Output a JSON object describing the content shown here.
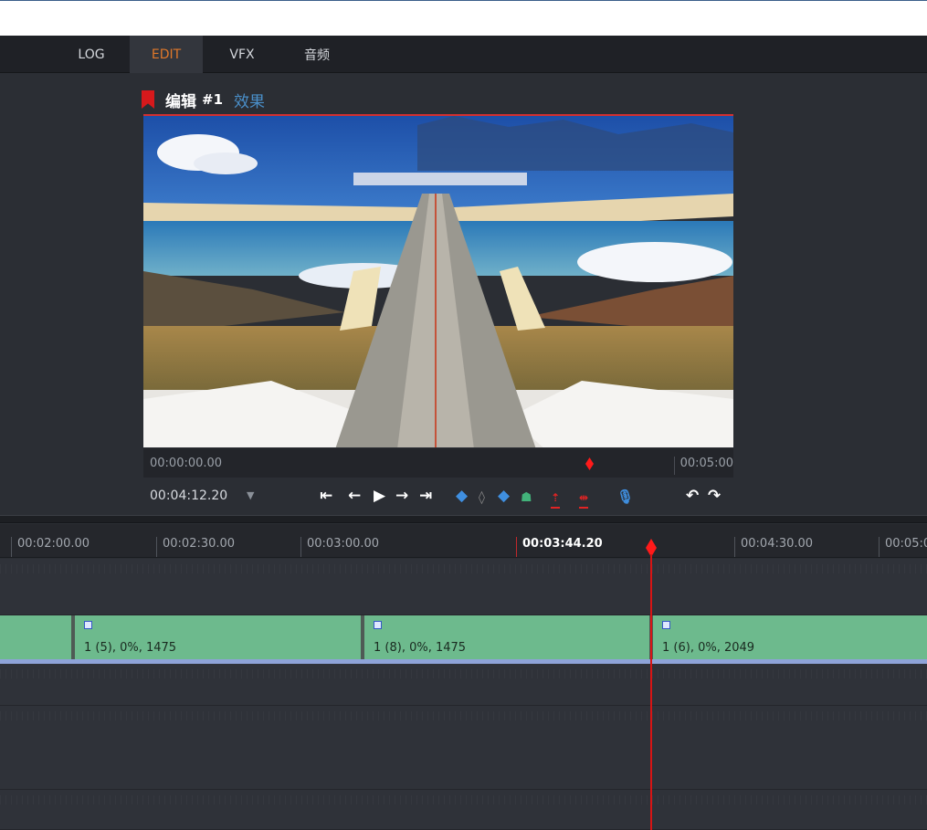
{
  "tabs": [
    {
      "label": "LOG",
      "active": false
    },
    {
      "label": "EDIT",
      "active": true
    },
    {
      "label": "VFX",
      "active": false
    },
    {
      "label": "音频",
      "active": false
    }
  ],
  "viewer": {
    "title": "编辑",
    "number": "#1",
    "effects_label": "效果",
    "scrub_start": "00:00:00.00",
    "scrub_end": "00:05:00",
    "timecode": "00:04:12.20",
    "timecode_dropdown": "▼"
  },
  "transport_icons": [
    {
      "name": "go-to-start-icon",
      "glyph": "⇤"
    },
    {
      "name": "step-back-icon",
      "glyph": "←"
    },
    {
      "name": "play-icon",
      "glyph": "▶"
    },
    {
      "name": "step-forward-icon",
      "glyph": "→"
    },
    {
      "name": "go-to-end-icon",
      "glyph": "⇥"
    },
    {
      "name": "mark-in-icon",
      "glyph": "◆"
    },
    {
      "name": "clear-mark-icon",
      "glyph": "◊"
    },
    {
      "name": "mark-out-icon",
      "glyph": "◆"
    },
    {
      "name": "add-marker-icon",
      "glyph": "☗"
    },
    {
      "name": "lift-icon",
      "glyph": "⇡"
    },
    {
      "name": "extract-icon",
      "glyph": "⇹"
    },
    {
      "name": "voiceover-mic-icon",
      "glyph": "🎙"
    },
    {
      "name": "undo-icon",
      "glyph": "↶"
    },
    {
      "name": "redo-icon",
      "glyph": "↷"
    }
  ],
  "timeline": {
    "ruler_labels": [
      "00:02:00.00",
      "00:02:30.00",
      "00:03:00.00",
      "00:03:44.20",
      "00:04:30.00",
      "00:05:0"
    ],
    "current_time": "00:03:44.20",
    "clips": [
      {
        "label": ""
      },
      {
        "label": "1 (5), 0%, 1475"
      },
      {
        "label": "1 (8), 0%, 1475"
      },
      {
        "label": "1 (6), 0%, 2049"
      }
    ]
  },
  "colors": {
    "accent_tab": "#e0782a",
    "playhead": "#d81414",
    "clip": "#6dba8d",
    "effects_link": "#4a8fc9"
  }
}
